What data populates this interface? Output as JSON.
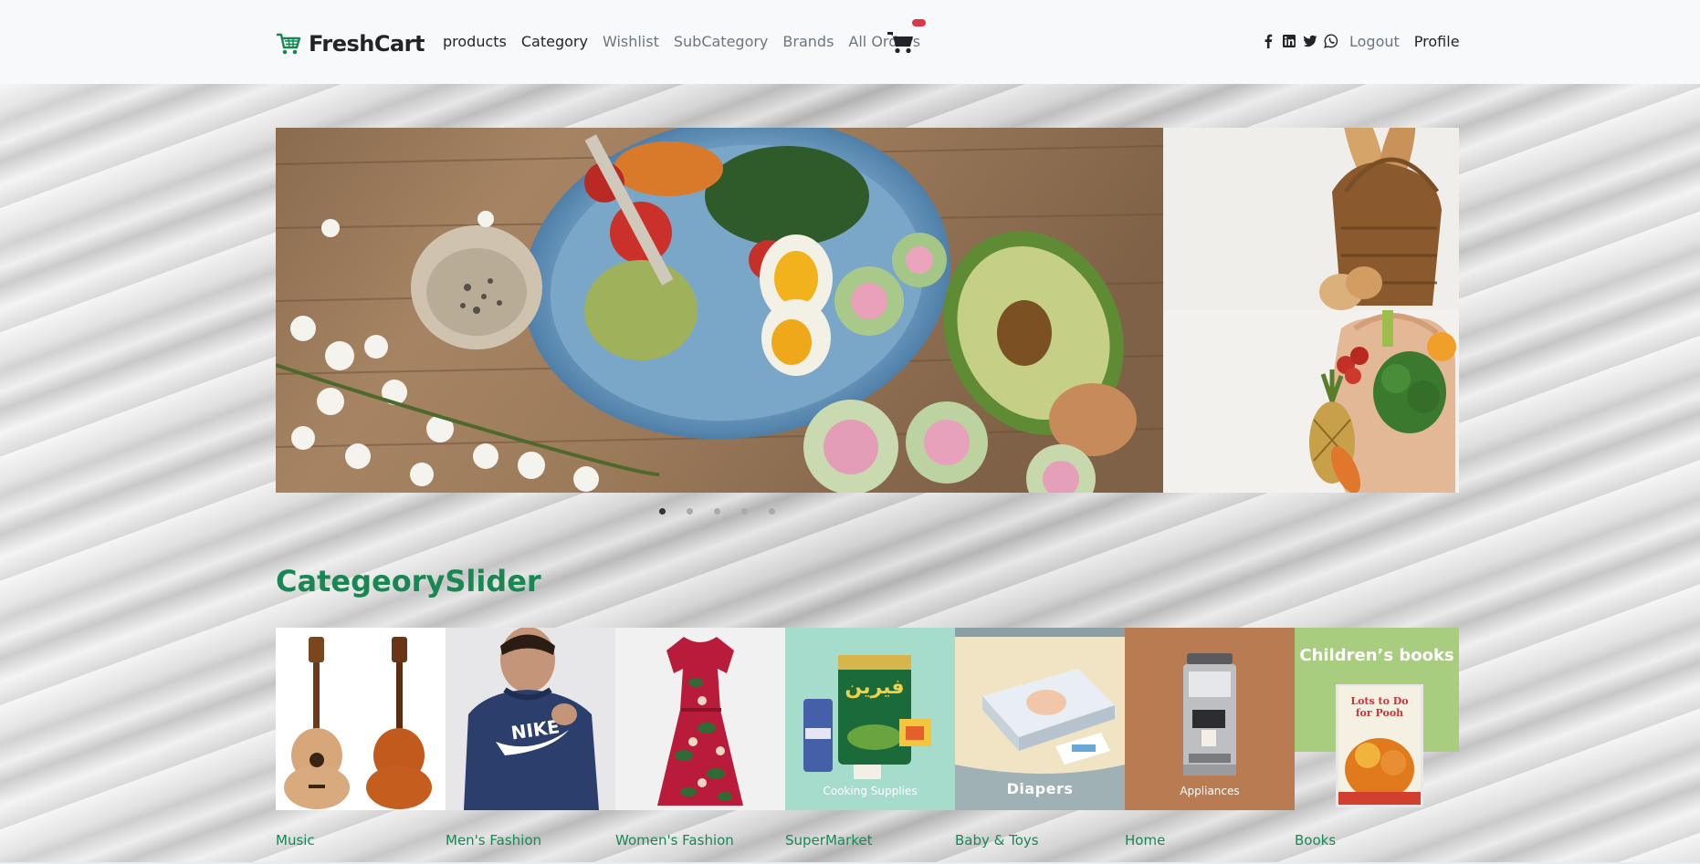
{
  "brand": {
    "name": "FreshCart",
    "icon": "cart-logo-icon",
    "color": "#198754"
  },
  "nav": {
    "links": [
      "products",
      "Category",
      "Wishlist",
      "SubCategory",
      "Brands",
      "All Orders"
    ],
    "cart_icon": "shopping-cart-icon",
    "social_icons": [
      "facebook-icon",
      "linkedin-icon",
      "twitter-icon",
      "whatsapp-icon"
    ],
    "logout": "Logout",
    "profile": "Profile"
  },
  "main_slider": {
    "slide_count": 5,
    "active_index": 0
  },
  "category_slider": {
    "title": "CategeorySlider",
    "title_color": "#198754",
    "categories": [
      {
        "name": "Music",
        "caption": ""
      },
      {
        "name": "Men's Fashion",
        "caption": ""
      },
      {
        "name": "Women's Fashion",
        "caption": ""
      },
      {
        "name": "SuperMarket",
        "caption": "Cooking Supplies"
      },
      {
        "name": "Baby & Toys",
        "caption": "Diapers"
      },
      {
        "name": "Home",
        "caption": "Appliances"
      },
      {
        "name": "Books",
        "caption": "Children’s books"
      }
    ]
  }
}
